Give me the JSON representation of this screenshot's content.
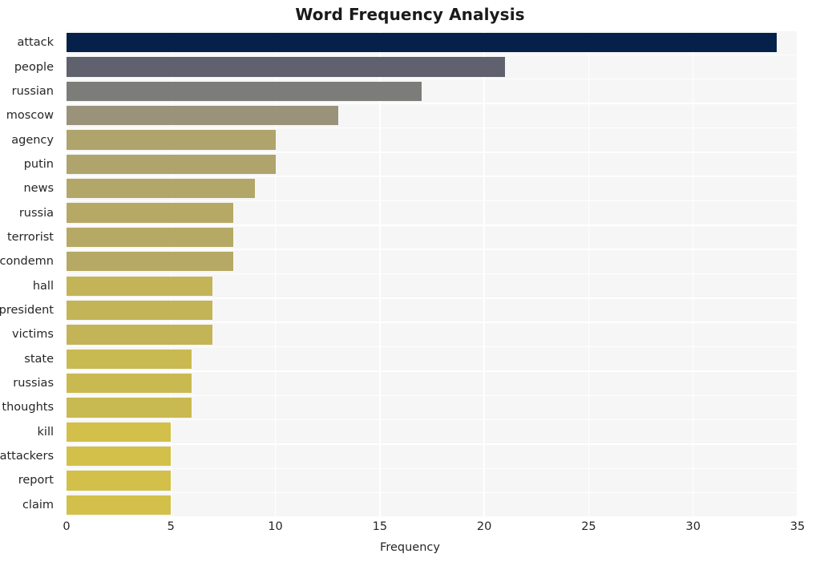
{
  "chart_data": {
    "type": "bar",
    "orientation": "horizontal",
    "title": "Word Frequency Analysis",
    "xlabel": "Frequency",
    "ylabel": "",
    "categories": [
      "attack",
      "people",
      "russian",
      "moscow",
      "agency",
      "putin",
      "news",
      "russia",
      "terrorist",
      "condemn",
      "hall",
      "president",
      "victims",
      "state",
      "russias",
      "thoughts",
      "kill",
      "attackers",
      "report",
      "claim"
    ],
    "values": [
      34,
      21,
      17,
      13,
      10,
      10,
      9,
      8,
      8,
      8,
      7,
      7,
      7,
      6,
      6,
      6,
      5,
      5,
      5,
      5
    ],
    "xlim": [
      0,
      35
    ],
    "xticks": [
      0,
      5,
      10,
      15,
      20,
      25,
      30,
      35
    ],
    "xtick_labels": [
      "0",
      "5",
      "10",
      "15",
      "20",
      "25",
      "30",
      "35"
    ],
    "grid": true,
    "grid_color": "#ffffff",
    "legend": false,
    "plot_background": "#f6f6f6",
    "figure_background": "#ffffff",
    "bar_colors": [
      "#052149",
      "#5f616e",
      "#7c7c79",
      "#9a9279",
      "#aea46c",
      "#aea46c",
      "#b2a768",
      "#b5a965",
      "#b5a965",
      "#b5a965",
      "#c3b457",
      "#c3b457",
      "#c3b457",
      "#c9b951",
      "#c9b951",
      "#c9b951",
      "#d2c04a",
      "#d2c04a",
      "#d2c04a",
      "#d2c04a"
    ]
  }
}
